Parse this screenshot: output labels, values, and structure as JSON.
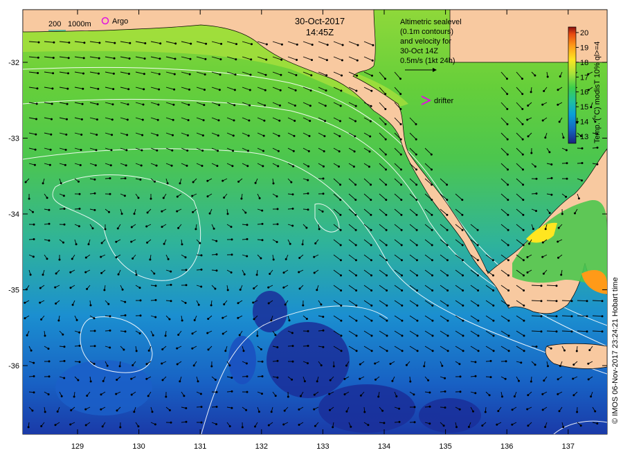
{
  "title": {
    "date": "30-Oct-2017",
    "time": "14:45Z"
  },
  "isobath_legend": {
    "depth_200": "200",
    "depth_1000": "1000m"
  },
  "argo_label": "Argo",
  "altimetry_note": [
    "Altimetric sealevel",
    "(0.1m contours)",
    "and velocity for",
    "30-Oct 14Z",
    "0.5m/s (1kt 24h)"
  ],
  "drifter_label": "drifter",
  "colorbar": {
    "label": "Temp. (°C) modisT 10% ql>=4",
    "ticks": [
      "13",
      "14",
      "15",
      "16",
      "17",
      "18",
      "19",
      "20"
    ],
    "colors": [
      "#1a237e",
      "#1565c0",
      "#0aa0d8",
      "#1fc0a0",
      "#3ccf4a",
      "#a8e23a",
      "#ffe620",
      "#ff9a18",
      "#e84a10",
      "#8b1010"
    ]
  },
  "axes": {
    "x_ticks": [
      "129",
      "130",
      "131",
      "132",
      "133",
      "134",
      "135",
      "136",
      "137"
    ],
    "y_ticks": [
      "-32",
      "-33",
      "-34",
      "-35",
      "-36"
    ]
  },
  "credit": "© IMOS 06-Nov-2017 23:24:21 Hobart time",
  "colors": {
    "land": "#f8c9a0",
    "arrow": "#000000",
    "contour": "#ffffff"
  }
}
